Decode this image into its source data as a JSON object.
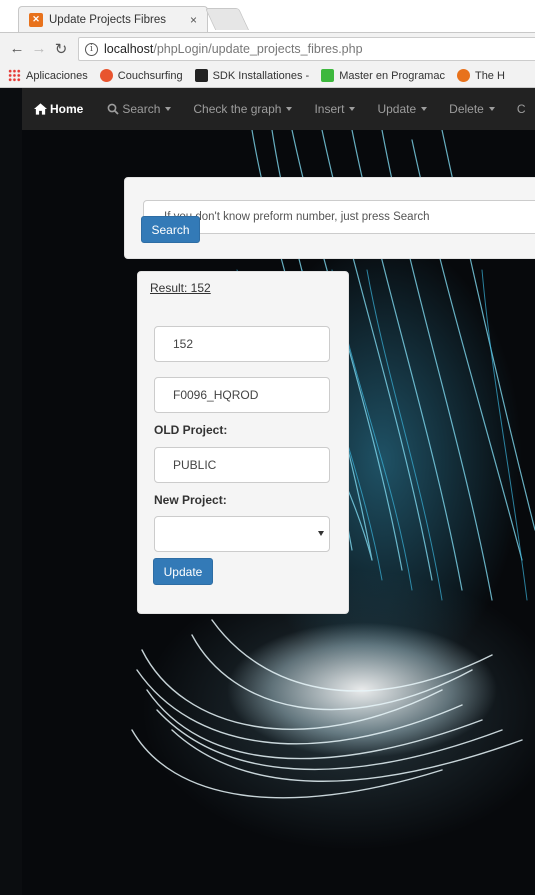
{
  "browser": {
    "tab_title": "Update Projects Fibres",
    "tab_close": "×",
    "url_host": "localhost",
    "url_path": "/phpLogin/update_projects_fibres.php",
    "bookmarks": [
      {
        "label": "Aplicaciones",
        "icon": "apps-grid-icon",
        "color": "#e53935"
      },
      {
        "label": "Couchsurfing",
        "icon": "couchsurfing-icon",
        "color": "#e8542f"
      },
      {
        "label": "SDK Installationes -",
        "icon": "sdk-icon",
        "color": "#222222"
      },
      {
        "label": "Master en Programac",
        "icon": "master-icon",
        "color": "#3db83d"
      },
      {
        "label": "The H",
        "icon": "the-h-icon",
        "color": "#e8721c"
      }
    ]
  },
  "navbar": {
    "home": "Home",
    "items": [
      {
        "label": "Search",
        "icon": "search-icon"
      },
      {
        "label": "Check the graph"
      },
      {
        "label": "Insert"
      },
      {
        "label": "Update"
      },
      {
        "label": "Delete"
      },
      {
        "label": "C"
      }
    ]
  },
  "search_panel": {
    "placeholder": "If you don't know preform number, just press Search",
    "button": "Search"
  },
  "result_panel": {
    "result_link": "Result: 152",
    "preform_value": "152",
    "fibre_value": "F0096_HQROD",
    "old_project_label": "OLD Project:",
    "old_project_value": "PUBLIC",
    "new_project_label": "New Project:",
    "new_project_selected": "",
    "button": "Update"
  },
  "colors": {
    "navbar_bg": "#222222",
    "primary_button": "#337ab7",
    "panel_bg": "#f5f5f5"
  }
}
